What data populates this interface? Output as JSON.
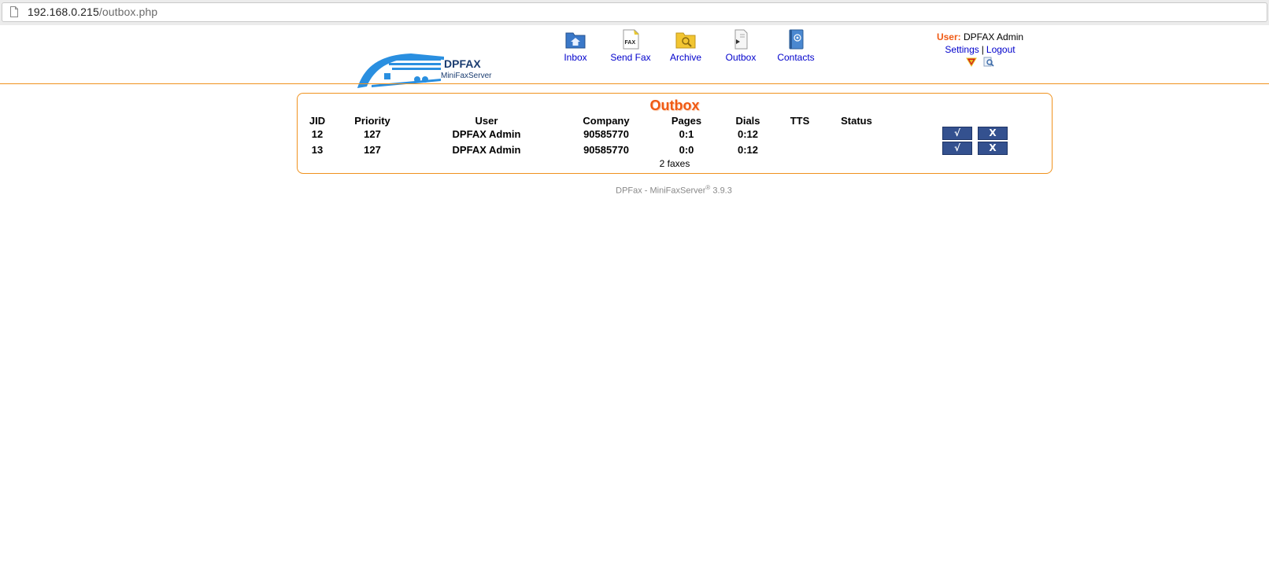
{
  "browser": {
    "url_host": "192.168.0.215",
    "url_path": "/outbox.php"
  },
  "header": {
    "logo": {
      "brand": "DPFAX",
      "product": "MiniFaxServer"
    },
    "nav": [
      {
        "label": "Inbox",
        "icon": "inbox-folder-icon"
      },
      {
        "label": "Send Fax",
        "icon": "send-fax-icon"
      },
      {
        "label": "Archive",
        "icon": "archive-folder-icon"
      },
      {
        "label": "Outbox",
        "icon": "outbox-document-icon"
      },
      {
        "label": "Contacts",
        "icon": "contacts-book-icon"
      }
    ],
    "user": {
      "label": "User:",
      "name": "DPFAX Admin",
      "settings": "Settings",
      "separator": "|",
      "logout": "Logout"
    }
  },
  "outbox": {
    "title": "Outbox",
    "columns": [
      "JID",
      "Priority",
      "User",
      "Company",
      "Pages",
      "Dials",
      "TTS",
      "Status"
    ],
    "rows": [
      {
        "jid": "12",
        "priority": "127",
        "user": "DPFAX Admin",
        "company": "90585770",
        "pages": "0:1",
        "dials": "0:12",
        "tts": "",
        "status": "",
        "approve": "√",
        "cancel": "X"
      },
      {
        "jid": "13",
        "priority": "127",
        "user": "DPFAX Admin",
        "company": "90585770",
        "pages": "0:0",
        "dials": "0:12",
        "tts": "",
        "status": "",
        "approve": "√",
        "cancel": "X"
      }
    ],
    "count": "2 faxes"
  },
  "footer": {
    "text": "DPFax - MiniFaxServer",
    "reg": "®",
    "version": "3.9.3"
  },
  "colors": {
    "accent_orange": "#f0921e",
    "title_orange": "#f05a14",
    "link_blue": "#0000cc",
    "button_blue": "#34518f"
  }
}
